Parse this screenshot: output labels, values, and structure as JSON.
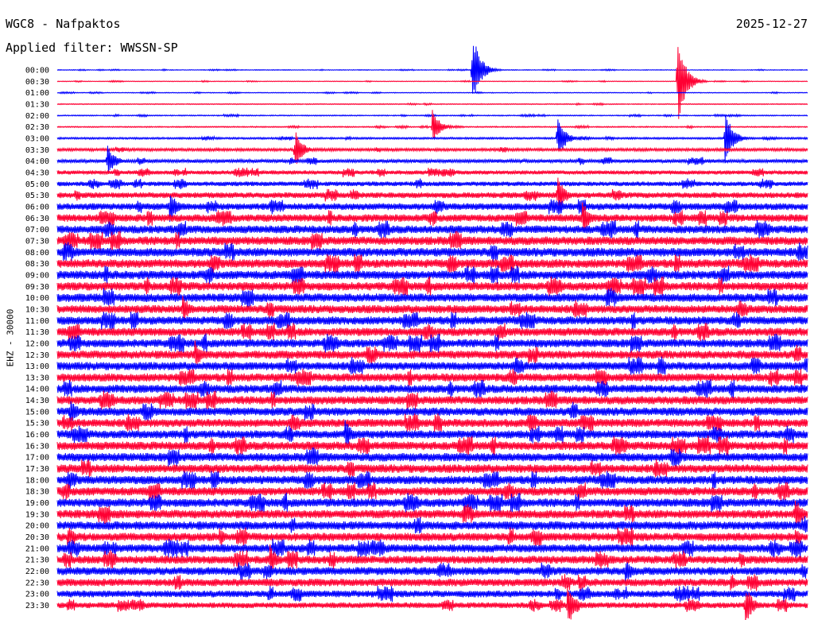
{
  "header": {
    "title": "WGC8 - Nafpaktos",
    "date": "2025-12-27",
    "filter": "Applied filter: WWSSN-SP"
  },
  "chart_data": {
    "type": "line",
    "title": "WGC8 - Nafpaktos",
    "subtitle": "Applied filter: WWSSN-SP",
    "xlabel": "",
    "ylabel": "EHZ - 30000",
    "date": "2025-12-27",
    "ytick_labels": [
      "00:00",
      "00:30",
      "01:00",
      "01:30",
      "02:00",
      "02:30",
      "03:00",
      "03:30",
      "04:00",
      "04:30",
      "05:00",
      "05:30",
      "06:00",
      "06:30",
      "07:00",
      "07:30",
      "08:00",
      "08:30",
      "09:00",
      "09:30",
      "10:00",
      "10:30",
      "11:00",
      "11:30",
      "12:00",
      "12:30",
      "13:00",
      "13:30",
      "14:00",
      "14:30",
      "15:00",
      "15:30",
      "16:00",
      "16:30",
      "17:00",
      "17:30",
      "18:00",
      "18:30",
      "19:00",
      "19:30",
      "20:00",
      "20:30",
      "21:00",
      "21:30",
      "22:00",
      "22:30",
      "23:00",
      "23:30"
    ],
    "trace_colors": [
      "#0000ff",
      "#ff0033"
    ],
    "noise_level": [
      0.03,
      0.03,
      0.035,
      0.04,
      0.045,
      0.05,
      0.08,
      0.12,
      0.15,
      0.18,
      0.2,
      0.25,
      0.3,
      0.33,
      0.35,
      0.37,
      0.38,
      0.38,
      0.38,
      0.37,
      0.37,
      0.36,
      0.36,
      0.36,
      0.36,
      0.36,
      0.36,
      0.36,
      0.36,
      0.36,
      0.36,
      0.36,
      0.36,
      0.37,
      0.37,
      0.37,
      0.37,
      0.37,
      0.37,
      0.37,
      0.37,
      0.36,
      0.36,
      0.35,
      0.35,
      0.33,
      0.3,
      0.25
    ],
    "events": [
      {
        "row": 0,
        "minute": 16.6,
        "amplitude": 3.5
      },
      {
        "row": 1,
        "minute": 24.8,
        "amplitude": 4.5
      },
      {
        "row": 5,
        "minute": 15.0,
        "amplitude": 1.5
      },
      {
        "row": 6,
        "minute": 20.0,
        "amplitude": 2.0
      },
      {
        "row": 6,
        "minute": 26.7,
        "amplitude": 2.5
      },
      {
        "row": 7,
        "minute": 9.5,
        "amplitude": 1.8
      },
      {
        "row": 8,
        "minute": 2.0,
        "amplitude": 1.5
      },
      {
        "row": 11,
        "minute": 20.0,
        "amplitude": 1.8
      },
      {
        "row": 12,
        "minute": 4.5,
        "amplitude": 1.5
      },
      {
        "row": 13,
        "minute": 21.0,
        "amplitude": 1.6
      },
      {
        "row": 21,
        "minute": 5.0,
        "amplitude": 1.4
      },
      {
        "row": 25,
        "minute": 5.5,
        "amplitude": 1.3
      },
      {
        "row": 30,
        "minute": 0.5,
        "amplitude": 1.4
      },
      {
        "row": 32,
        "minute": 11.5,
        "amplitude": 1.5
      },
      {
        "row": 39,
        "minute": 29.5,
        "amplitude": 1.6
      },
      {
        "row": 43,
        "minute": 8.5,
        "amplitude": 1.4
      },
      {
        "row": 44,
        "minute": 22.7,
        "amplitude": 1.3
      },
      {
        "row": 47,
        "minute": 20.4,
        "amplitude": 2.0
      },
      {
        "row": 47,
        "minute": 27.5,
        "amplitude": 2.0
      }
    ]
  }
}
